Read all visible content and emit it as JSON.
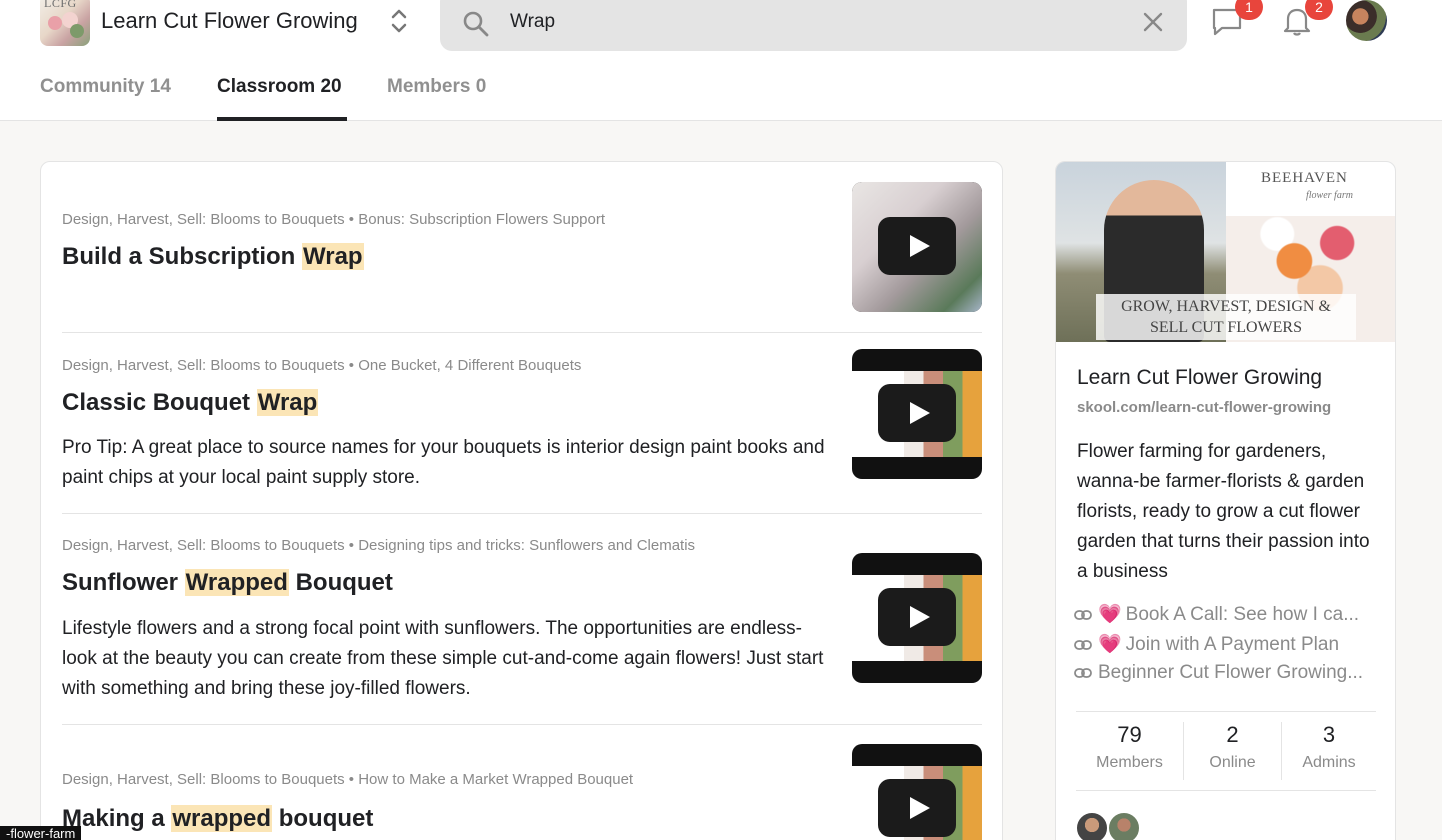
{
  "header": {
    "logo_text": "LCFG",
    "group_name": "Learn Cut Flower Growing",
    "search_value": "Wrap",
    "chat_badge": "1",
    "notif_badge": "2",
    "tabs": [
      {
        "label": "Community 14",
        "active": false
      },
      {
        "label": "Classroom 20",
        "active": true
      },
      {
        "label": "Members 0",
        "active": false
      }
    ]
  },
  "results": [
    {
      "crumb": "Design, Harvest, Sell: Blooms to Bouquets • Bonus: Subscription Flowers Support",
      "title_before": "Build a Subscription ",
      "title_highlight": "Wrap",
      "title_after": "",
      "description": "",
      "thumbnail_style": "light"
    },
    {
      "crumb": "Design, Harvest, Sell: Blooms to Bouquets • One Bucket, 4 Different Bouquets",
      "title_before": "Classic Bouquet ",
      "title_highlight": "Wrap",
      "title_after": "",
      "description": "Pro Tip: A great place to source names for your bouquets is interior design paint books and paint chips at your local paint supply store.",
      "thumbnail_style": "dark"
    },
    {
      "crumb": "Design, Harvest, Sell: Blooms to Bouquets • Designing tips and tricks: Sunflowers and Clematis",
      "title_before": "Sunflower ",
      "title_highlight": "Wrapped",
      "title_after": " Bouquet",
      "description": "Lifestyle flowers and a strong focal point with sunflowers. The opportunities are endless- look at the beauty you can create from these simple cut-and-come again flowers! Just start with something and bring these joy-filled flowers.",
      "thumbnail_style": "dark"
    },
    {
      "crumb": "Design, Harvest, Sell: Blooms to Bouquets • How to Make a Market Wrapped Bouquet",
      "title_before": "Making a ",
      "title_highlight": "wrapped",
      "title_after": " bouquet",
      "description": "",
      "thumbnail_style": "dark"
    }
  ],
  "about": {
    "cover_brand": "BEEHAVEN",
    "cover_brand_sub": "flower farm",
    "cover_tagline": "GROW, HARVEST, DESIGN & SELL CUT FLOWERS",
    "name": "Learn Cut Flower Growing",
    "url": "skool.com/learn-cut-flower-growing",
    "description": "Flower farming for gardeners, wanna-be farmer-florists & garden florists, ready to grow a cut flower garden that turns their passion into a business",
    "links": [
      {
        "heart": "💗",
        "label": "Book A Call: See how I ca..."
      },
      {
        "heart": "💗",
        "label": "Join with A Payment Plan"
      },
      {
        "heart": "",
        "label": "Beginner Cut Flower Growing..."
      }
    ],
    "stats": [
      {
        "value": "79",
        "label": "Members"
      },
      {
        "value": "2",
        "label": "Online"
      },
      {
        "value": "3",
        "label": "Admins"
      }
    ]
  },
  "status_tooltip": "-flower-farm",
  "colors": {
    "highlight": "#fbe5b6",
    "badge": "#e8453c",
    "heart": "#e84a8a"
  }
}
